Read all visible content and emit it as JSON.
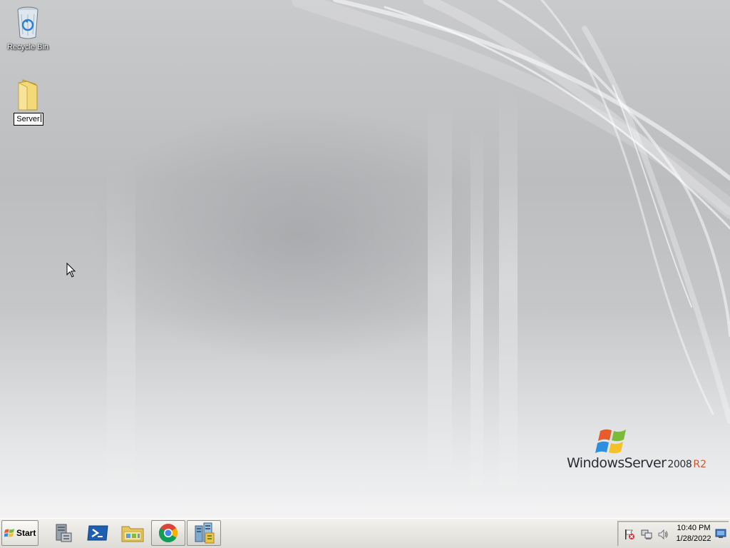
{
  "desktop": {
    "icons": [
      {
        "name": "recycle-bin",
        "label": "Recycle Bin"
      },
      {
        "name": "server-folder",
        "label": "Server",
        "editing": true
      }
    ],
    "branding": {
      "word1": "Windows",
      "word2": "Server",
      "year": "2008",
      "edition": "R2"
    }
  },
  "taskbar": {
    "start_label": "Start",
    "pinned": [
      {
        "name": "server-manager",
        "icon": "server-manager-icon"
      },
      {
        "name": "powershell",
        "icon": "powershell-icon"
      },
      {
        "name": "windows-explorer",
        "icon": "folder-icon"
      },
      {
        "name": "google-chrome",
        "icon": "chrome-icon"
      },
      {
        "name": "network-tool",
        "icon": "network-tool-icon"
      }
    ],
    "tray": {
      "icons": [
        "action-center-icon",
        "network-icon",
        "volume-icon"
      ],
      "time": "10:40 PM",
      "date": "1/28/2022"
    }
  },
  "colors": {
    "taskbar": "#e8e6e1",
    "brand_accent": "#d8532a"
  }
}
